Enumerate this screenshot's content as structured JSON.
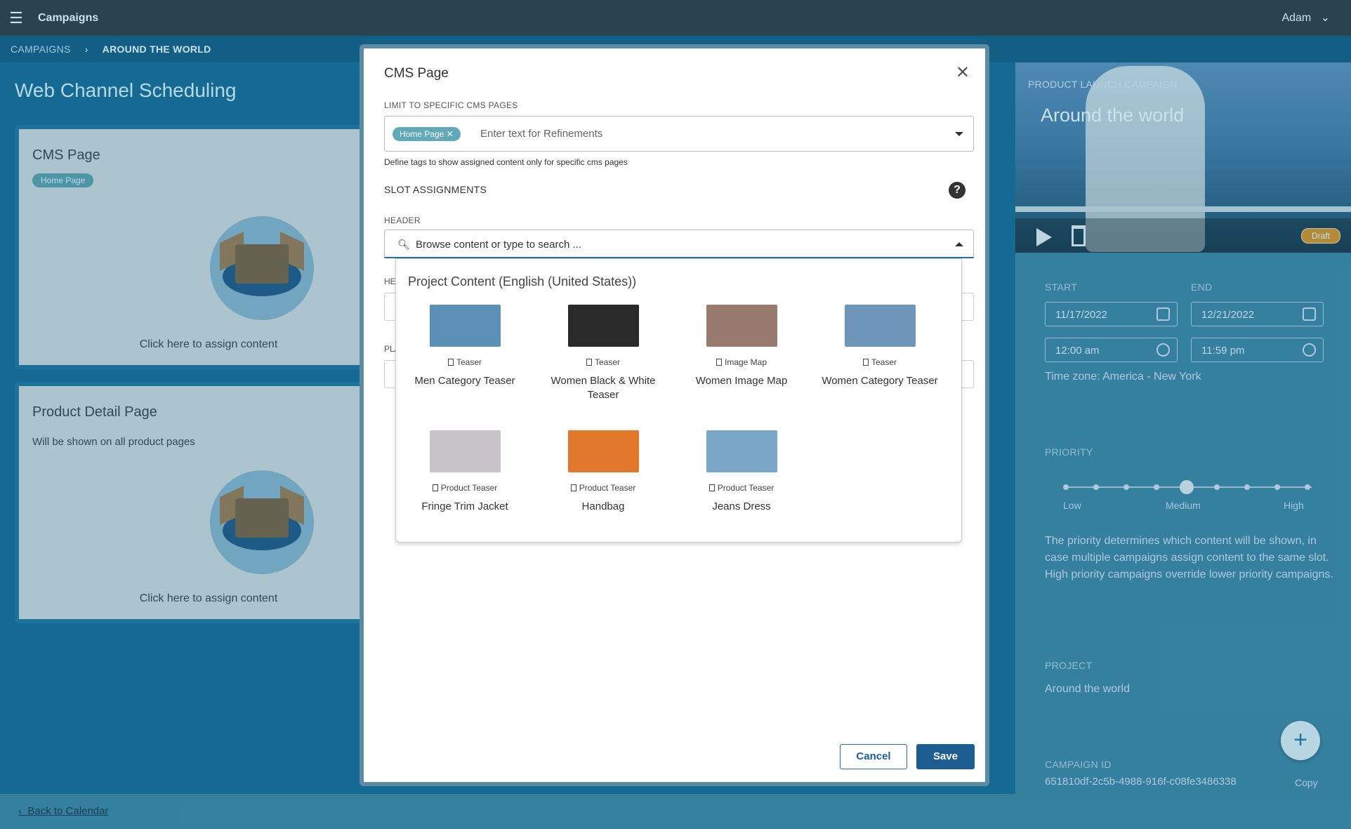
{
  "topbar": {
    "title": "Campaigns",
    "user": "Adam"
  },
  "breadcrumb": {
    "root": "CAMPAIGNS",
    "current": "AROUND THE WORLD"
  },
  "page": {
    "title": "Web Channel Scheduling"
  },
  "cards": [
    {
      "title": "CMS Page",
      "tag": "Home Page",
      "assign_text": "Click here to assign content"
    },
    {
      "title": "Product Detail Page",
      "description": "Will be shown on all product pages",
      "assign_text": "Click here to assign content"
    }
  ],
  "campaign": {
    "kicker": "PRODUCT LAUNCH CAMPAIGN",
    "name": "Around the world",
    "status": "Draft",
    "start_label": "START",
    "end_label": "END",
    "start_date": "11/17/2022",
    "end_date": "12/21/2022",
    "start_time": "12:00 am",
    "end_time": "11:59 pm",
    "timezone": "Time zone: America - New York",
    "priority_label": "PRIORITY",
    "priority_low": "Low",
    "priority_medium": "Medium",
    "priority_high": "High",
    "priority_value": 0.5,
    "priority_text": "The priority determines which content will be shown, in case multiple campaigns assign content to the same slot. High priority campaigns override lower priority campaigns.",
    "project_label": "PROJECT",
    "project": "Around the world",
    "id_label": "CAMPAIGN ID",
    "id": "651810df-2c5b-4988-916f-c08fe3486338",
    "copy": "Copy"
  },
  "footer": {
    "back": "Back to Calendar"
  },
  "modal": {
    "title": "CMS Page",
    "limit_label": "LIMIT TO SPECIFIC CMS PAGES",
    "chip": "Home Page",
    "refine_placeholder": "Enter text for Refinements",
    "hint": "Define tags to show assigned content only for specific cms pages",
    "slot_heading": "SLOT ASSIGNMENTS",
    "header_label": "HEADER",
    "search_placeholder": "Browse content or type to search ...",
    "hidden_label_1": "HEI",
    "hidden_label_2": "PLA",
    "cancel": "Cancel",
    "save": "Save",
    "dropdown": {
      "title": "Project Content (English (United States))",
      "items": [
        {
          "type": "Teaser",
          "name": "Men Category Teaser",
          "color": "#5b8fb5"
        },
        {
          "type": "Teaser",
          "name": "Women Black & White Teaser",
          "color": "#2a2a2a"
        },
        {
          "type": "Image Map",
          "name": "Women Image Map",
          "color": "#9a7a6e"
        },
        {
          "type": "Teaser",
          "name": "Women Category Teaser",
          "color": "#6f96b8"
        },
        {
          "type": "Product Teaser",
          "name": "Fringe Trim Jacket",
          "color": "#c7c3c8"
        },
        {
          "type": "Product Teaser",
          "name": "Handbag",
          "color": "#e2782c"
        },
        {
          "type": "Product Teaser",
          "name": "Jeans Dress",
          "color": "#7aa6c8"
        }
      ]
    }
  }
}
